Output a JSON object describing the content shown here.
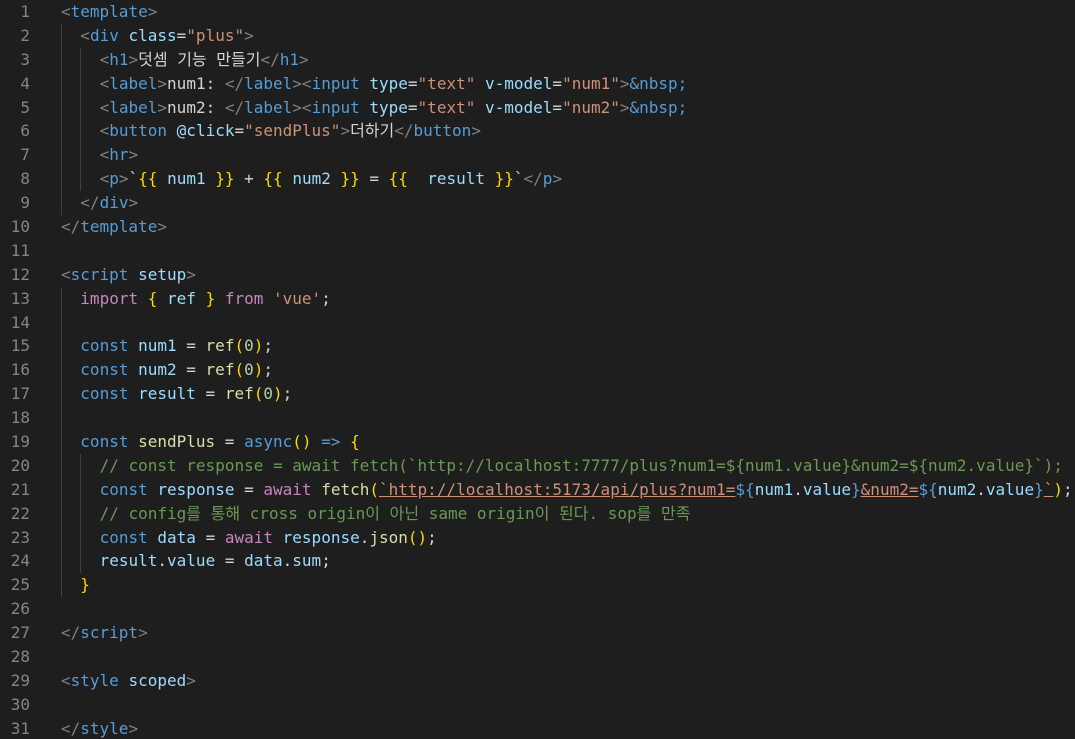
{
  "editor": {
    "language": "vue",
    "colors": {
      "background": "#1e1e1e",
      "line_number": "#858585",
      "tag": "#569cd6",
      "attribute": "#9cdcfe",
      "string": "#ce9178",
      "keyword": "#569cd6",
      "control": "#c586c0",
      "function": "#dcdcaa",
      "number": "#b5cea8",
      "comment": "#6a9955",
      "bracket": "#ffd700"
    },
    "lines": [
      {
        "n": "1",
        "indent": 0,
        "tokens": [
          [
            "tagbr",
            "<"
          ],
          [
            "tag",
            "template"
          ],
          [
            "tagbr",
            ">"
          ]
        ]
      },
      {
        "n": "2",
        "indent": 1,
        "tokens": [
          [
            "tagbr",
            "<"
          ],
          [
            "tag",
            "div"
          ],
          [
            "txt",
            " "
          ],
          [
            "attr",
            "class"
          ],
          [
            "txt",
            "="
          ],
          [
            "str",
            "\"plus\""
          ],
          [
            "tagbr",
            ">"
          ]
        ]
      },
      {
        "n": "3",
        "indent": 2,
        "tokens": [
          [
            "tagbr",
            "<"
          ],
          [
            "tag",
            "h1"
          ],
          [
            "tagbr",
            ">"
          ],
          [
            "txt",
            "덧셈 기능 만들기"
          ],
          [
            "tagbr",
            "</"
          ],
          [
            "tag",
            "h1"
          ],
          [
            "tagbr",
            ">"
          ]
        ]
      },
      {
        "n": "4",
        "indent": 2,
        "tokens": [
          [
            "tagbr",
            "<"
          ],
          [
            "tag",
            "label"
          ],
          [
            "tagbr",
            ">"
          ],
          [
            "txt",
            "num1: "
          ],
          [
            "tagbr",
            "</"
          ],
          [
            "tag",
            "label"
          ],
          [
            "tagbr",
            ">"
          ],
          [
            "tagbr",
            "<"
          ],
          [
            "tag",
            "input"
          ],
          [
            "txt",
            " "
          ],
          [
            "attr",
            "type"
          ],
          [
            "txt",
            "="
          ],
          [
            "str",
            "\"text\""
          ],
          [
            "txt",
            " "
          ],
          [
            "attr",
            "v-model"
          ],
          [
            "txt",
            "="
          ],
          [
            "str",
            "\"num1\""
          ],
          [
            "tagbr",
            ">"
          ],
          [
            "ent",
            "&nbsp;"
          ]
        ]
      },
      {
        "n": "5",
        "indent": 2,
        "tokens": [
          [
            "tagbr",
            "<"
          ],
          [
            "tag",
            "label"
          ],
          [
            "tagbr",
            ">"
          ],
          [
            "txt",
            "num2: "
          ],
          [
            "tagbr",
            "</"
          ],
          [
            "tag",
            "label"
          ],
          [
            "tagbr",
            ">"
          ],
          [
            "tagbr",
            "<"
          ],
          [
            "tag",
            "input"
          ],
          [
            "txt",
            " "
          ],
          [
            "attr",
            "type"
          ],
          [
            "txt",
            "="
          ],
          [
            "str",
            "\"text\""
          ],
          [
            "txt",
            " "
          ],
          [
            "attr",
            "v-model"
          ],
          [
            "txt",
            "="
          ],
          [
            "str",
            "\"num2\""
          ],
          [
            "tagbr",
            ">"
          ],
          [
            "ent",
            "&nbsp;"
          ]
        ]
      },
      {
        "n": "6",
        "indent": 2,
        "tokens": [
          [
            "tagbr",
            "<"
          ],
          [
            "tag",
            "button"
          ],
          [
            "txt",
            " "
          ],
          [
            "attr",
            "@click"
          ],
          [
            "txt",
            "="
          ],
          [
            "str",
            "\"sendPlus\""
          ],
          [
            "tagbr",
            ">"
          ],
          [
            "txt",
            "더하기"
          ],
          [
            "tagbr",
            "</"
          ],
          [
            "tag",
            "button"
          ],
          [
            "tagbr",
            ">"
          ]
        ]
      },
      {
        "n": "7",
        "indent": 2,
        "tokens": [
          [
            "tagbr",
            "<"
          ],
          [
            "tag",
            "hr"
          ],
          [
            "tagbr",
            ">"
          ]
        ]
      },
      {
        "n": "8",
        "indent": 2,
        "tokens": [
          [
            "tagbr",
            "<"
          ],
          [
            "tag",
            "p"
          ],
          [
            "tagbr",
            ">"
          ],
          [
            "txt",
            "`"
          ],
          [
            "br",
            "{{"
          ],
          [
            "txt",
            " "
          ],
          [
            "var",
            "num1"
          ],
          [
            "txt",
            " "
          ],
          [
            "br",
            "}}"
          ],
          [
            "txt",
            " + "
          ],
          [
            "br",
            "{{"
          ],
          [
            "txt",
            " "
          ],
          [
            "var",
            "num2"
          ],
          [
            "txt",
            " "
          ],
          [
            "br",
            "}}"
          ],
          [
            "txt",
            " = "
          ],
          [
            "br",
            "{{"
          ],
          [
            "txt",
            "  "
          ],
          [
            "var",
            "result"
          ],
          [
            "txt",
            " "
          ],
          [
            "br",
            "}}"
          ],
          [
            "txt",
            "`"
          ],
          [
            "tagbr",
            "</"
          ],
          [
            "tag",
            "p"
          ],
          [
            "tagbr",
            ">"
          ]
        ]
      },
      {
        "n": "9",
        "indent": 1,
        "tokens": [
          [
            "tagbr",
            "</"
          ],
          [
            "tag",
            "div"
          ],
          [
            "tagbr",
            ">"
          ]
        ]
      },
      {
        "n": "10",
        "indent": 0,
        "tokens": [
          [
            "tagbr",
            "</"
          ],
          [
            "tag",
            "template"
          ],
          [
            "tagbr",
            ">"
          ]
        ]
      },
      {
        "n": "11",
        "indent": 0,
        "tokens": []
      },
      {
        "n": "12",
        "indent": 0,
        "tokens": [
          [
            "tagbr",
            "<"
          ],
          [
            "tag",
            "script"
          ],
          [
            "txt",
            " "
          ],
          [
            "attr",
            "setup"
          ],
          [
            "tagbr",
            ">"
          ]
        ]
      },
      {
        "n": "13",
        "indent": 1,
        "tokens": [
          [
            "ctl",
            "import"
          ],
          [
            "txt",
            " "
          ],
          [
            "br",
            "{"
          ],
          [
            "txt",
            " "
          ],
          [
            "var",
            "ref"
          ],
          [
            "txt",
            " "
          ],
          [
            "br",
            "}"
          ],
          [
            "txt",
            " "
          ],
          [
            "ctl",
            "from"
          ],
          [
            "txt",
            " "
          ],
          [
            "str",
            "'vue'"
          ],
          [
            "txt",
            ";"
          ]
        ]
      },
      {
        "n": "14",
        "indent": 1,
        "tokens": []
      },
      {
        "n": "15",
        "indent": 1,
        "tokens": [
          [
            "kw",
            "const"
          ],
          [
            "txt",
            " "
          ],
          [
            "var",
            "num1"
          ],
          [
            "txt",
            " = "
          ],
          [
            "fn",
            "ref"
          ],
          [
            "br",
            "("
          ],
          [
            "num",
            "0"
          ],
          [
            "br",
            ")"
          ],
          [
            "txt",
            ";"
          ]
        ]
      },
      {
        "n": "16",
        "indent": 1,
        "tokens": [
          [
            "kw",
            "const"
          ],
          [
            "txt",
            " "
          ],
          [
            "var",
            "num2"
          ],
          [
            "txt",
            " = "
          ],
          [
            "fn",
            "ref"
          ],
          [
            "br",
            "("
          ],
          [
            "num",
            "0"
          ],
          [
            "br",
            ")"
          ],
          [
            "txt",
            ";"
          ]
        ]
      },
      {
        "n": "17",
        "indent": 1,
        "tokens": [
          [
            "kw",
            "const"
          ],
          [
            "txt",
            " "
          ],
          [
            "var",
            "result"
          ],
          [
            "txt",
            " = "
          ],
          [
            "fn",
            "ref"
          ],
          [
            "br",
            "("
          ],
          [
            "num",
            "0"
          ],
          [
            "br",
            ")"
          ],
          [
            "txt",
            ";"
          ]
        ]
      },
      {
        "n": "18",
        "indent": 1,
        "tokens": []
      },
      {
        "n": "19",
        "indent": 1,
        "tokens": [
          [
            "kw",
            "const"
          ],
          [
            "txt",
            " "
          ],
          [
            "fn",
            "sendPlus"
          ],
          [
            "txt",
            " = "
          ],
          [
            "kw",
            "async"
          ],
          [
            "br",
            "()"
          ],
          [
            "txt",
            " "
          ],
          [
            "kw",
            "=>"
          ],
          [
            "txt",
            " "
          ],
          [
            "br",
            "{"
          ]
        ]
      },
      {
        "n": "20",
        "indent": 2,
        "tokens": [
          [
            "cm",
            "// const response = await fetch(`http://localhost:7777/plus?num1=${num1.value}&num2=${num2.value}`);"
          ]
        ]
      },
      {
        "n": "21",
        "indent": 2,
        "tokens": [
          [
            "kw",
            "const"
          ],
          [
            "txt",
            " "
          ],
          [
            "var",
            "response"
          ],
          [
            "txt",
            " = "
          ],
          [
            "ctl",
            "await"
          ],
          [
            "txt",
            " "
          ],
          [
            "fn",
            "fetch"
          ],
          [
            "br",
            "("
          ],
          [
            "url",
            "`http://localhost:5173/api/plus?num1="
          ],
          [
            "kw",
            "${"
          ],
          [
            "var",
            "num1"
          ],
          [
            "txt",
            "."
          ],
          [
            "var",
            "value"
          ],
          [
            "kw",
            "}"
          ],
          [
            "url",
            "&num2="
          ],
          [
            "kw",
            "${"
          ],
          [
            "var",
            "num2"
          ],
          [
            "txt",
            "."
          ],
          [
            "var",
            "value"
          ],
          [
            "kw",
            "}"
          ],
          [
            "url",
            "`"
          ],
          [
            "br",
            ")"
          ],
          [
            "txt",
            ";"
          ]
        ]
      },
      {
        "n": "22",
        "indent": 2,
        "tokens": [
          [
            "cm",
            "// config를 통해 cross origin이 아닌 same origin이 된다. sop를 만족"
          ]
        ]
      },
      {
        "n": "23",
        "indent": 2,
        "tokens": [
          [
            "kw",
            "const"
          ],
          [
            "txt",
            " "
          ],
          [
            "var",
            "data"
          ],
          [
            "txt",
            " = "
          ],
          [
            "ctl",
            "await"
          ],
          [
            "txt",
            " "
          ],
          [
            "var",
            "response"
          ],
          [
            "txt",
            "."
          ],
          [
            "fn",
            "json"
          ],
          [
            "br",
            "()"
          ],
          [
            "txt",
            ";"
          ]
        ]
      },
      {
        "n": "24",
        "indent": 2,
        "tokens": [
          [
            "var",
            "result"
          ],
          [
            "txt",
            "."
          ],
          [
            "var",
            "value"
          ],
          [
            "txt",
            " = "
          ],
          [
            "var",
            "data"
          ],
          [
            "txt",
            "."
          ],
          [
            "var",
            "sum"
          ],
          [
            "txt",
            ";"
          ]
        ]
      },
      {
        "n": "25",
        "indent": 1,
        "tokens": [
          [
            "br",
            "}"
          ]
        ]
      },
      {
        "n": "26",
        "indent": 0,
        "tokens": []
      },
      {
        "n": "27",
        "indent": 0,
        "tokens": [
          [
            "tagbr",
            "</"
          ],
          [
            "tag",
            "script"
          ],
          [
            "tagbr",
            ">"
          ]
        ]
      },
      {
        "n": "28",
        "indent": 0,
        "tokens": []
      },
      {
        "n": "29",
        "indent": 0,
        "tokens": [
          [
            "tagbr",
            "<"
          ],
          [
            "tag",
            "style"
          ],
          [
            "txt",
            " "
          ],
          [
            "attr",
            "scoped"
          ],
          [
            "tagbr",
            ">"
          ]
        ]
      },
      {
        "n": "30",
        "indent": 0,
        "tokens": []
      },
      {
        "n": "31",
        "indent": 0,
        "tokens": [
          [
            "tagbr",
            "</"
          ],
          [
            "tag",
            "style"
          ],
          [
            "tagbr",
            ">"
          ]
        ]
      }
    ]
  }
}
